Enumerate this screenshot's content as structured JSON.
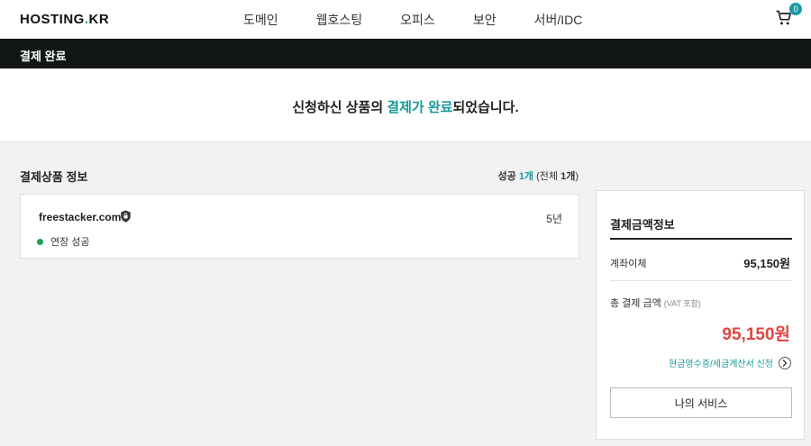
{
  "header": {
    "logo": "HOSTING",
    "logo_dot": ".",
    "logo_suffix": "KR",
    "nav": [
      "도메인",
      "웹호스팅",
      "오피스",
      "보안",
      "서버/IDC"
    ],
    "cart_count": "0"
  },
  "titlebar": {
    "title": "결제 완료"
  },
  "banner": {
    "prefix": "신청하신 상품의 ",
    "highlight": "결제가 완료",
    "suffix": "되었습니다."
  },
  "section": {
    "title": "결제상품 정보",
    "success_label": "성공 ",
    "success_count": "1개",
    "total_text": " (전체 ",
    "total_count": "1개",
    "total_close": ")"
  },
  "item": {
    "domain": "freestacker.com",
    "term": "5년",
    "status": "연장 성공"
  },
  "payment": {
    "title": "결제금액정보",
    "method_label": "계좌이체",
    "method_amount": "95,150원",
    "total_label": "총 결제 금액 ",
    "vat_note": "(VAT 포함)",
    "total_amount": "95,150원",
    "receipt_link": "현금영수증/세금계산서 신청",
    "my_service_button": "나의 서비스"
  },
  "colors": {
    "accent": "#1a9a9a",
    "total_red": "#e0443e",
    "success_green": "#1f9d55",
    "titlebar_bg": "#121715"
  }
}
